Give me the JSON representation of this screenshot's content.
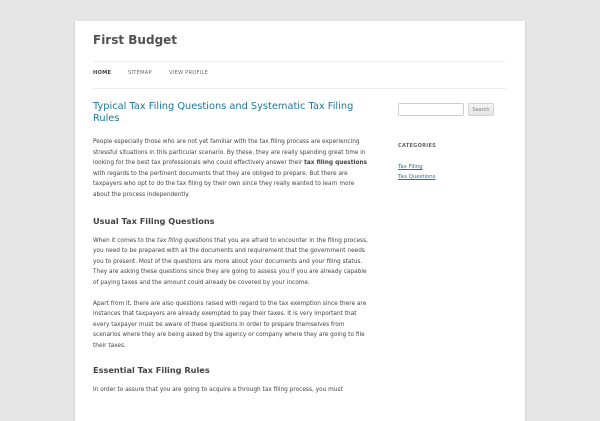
{
  "site": {
    "title": "First Budget"
  },
  "nav": {
    "items": [
      {
        "label": "HOME"
      },
      {
        "label": "SITEMAP"
      },
      {
        "label": "VIEW PROFILE"
      }
    ]
  },
  "post": {
    "title": "Typical Tax Filing Questions and Systematic Tax Filing Rules",
    "p1_a": "People especially those who are not yet familiar with the tax filing process are experiencing stressful situations in this particular scenario. By these, they are really spending great time in looking for the best tax professionals who could effectively answer their ",
    "p1_b": "tax filing questions",
    "p1_c": " with regards to the pertinent documents that they are obliged to prepare. But there are taxpayers who opt to do the tax filing by their own since they really wanted to learn more about the process independently.",
    "h_usual": "Usual Tax Filing Questions",
    "p2_a": "When it comes to the ",
    "p2_b": "tax filing questions",
    "p2_c": " that you are afraid to encounter in the filing process, you need to be prepared with all the documents and requirement that the government needs you to present. Most of the questions are more about your documents and your filing status. They are asking these questions since they are going to assess you if you are already capable of paying taxes and the amount could already be covered by your income.",
    "p3": "Apart from it, there are also questions raised with regard to the tax exemption since there are instances that taxpayers are already exempted to pay their taxes. It is very important that every taxpayer must be aware of these questions in order to prepare themselves from scenarios where they are being asked by the agency or company where they are going to file their taxes.",
    "h_essential": "Essential Tax Filing Rules",
    "p4": "In order to assure that you are going to acquire a through tax filing process, you must"
  },
  "sidebar": {
    "search_placeholder": "",
    "search_button": "Search",
    "categories_title": "CATEGORIES",
    "categories": [
      {
        "label": "Tax Filing"
      },
      {
        "label": "Tax Questions"
      }
    ]
  },
  "colors": {
    "link": "#21759b",
    "background": "#e6e6e6",
    "page": "#ffffff",
    "text": "#444444"
  }
}
